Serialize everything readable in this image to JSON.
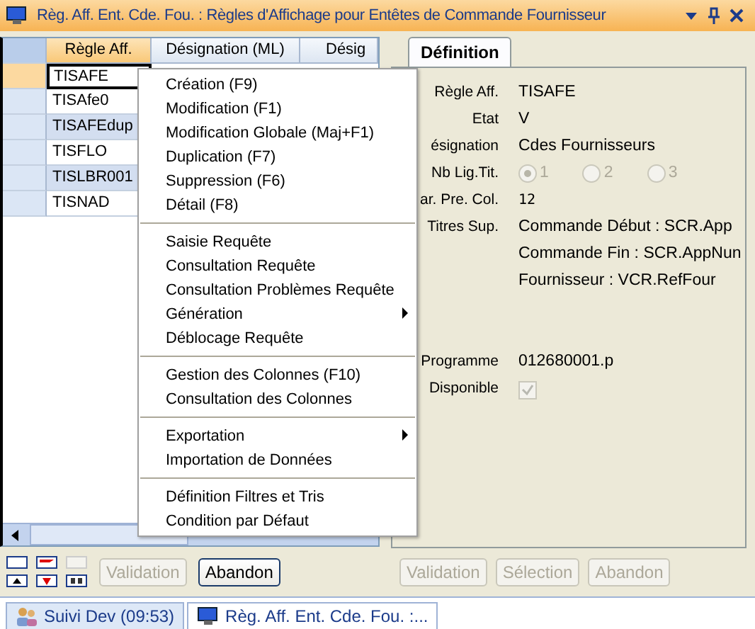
{
  "window": {
    "title": "Règ. Aff. Ent. Cde. Fou. : Règles d'Affichage pour Entêtes de Commande Fournisseur"
  },
  "grid": {
    "columns": [
      {
        "label": "Règle Aff.",
        "selected": true
      },
      {
        "label": "Désignation (ML)",
        "selected": false
      },
      {
        "label": "Désig",
        "selected": false
      }
    ],
    "rows": [
      {
        "rule": "TISAFE",
        "selected": true
      },
      {
        "rule": "TISAfe0",
        "selected": false
      },
      {
        "rule": "TISAFEdup",
        "selected": false
      },
      {
        "rule": "TISFLO",
        "selected": false
      },
      {
        "rule": "TISLBR001",
        "selected": false
      },
      {
        "rule": "TISNAD",
        "selected": false
      }
    ]
  },
  "left_buttons": [
    {
      "label": "Validation",
      "disabled": true
    },
    {
      "label": "Abandon",
      "disabled": false
    }
  ],
  "menu": [
    {
      "kind": "item",
      "label": "Création (F9)",
      "submenu": false
    },
    {
      "kind": "item",
      "label": "Modification (F1)",
      "submenu": false
    },
    {
      "kind": "item",
      "label": "Modification Globale (Maj+F1)",
      "submenu": false
    },
    {
      "kind": "item",
      "label": "Duplication (F7)",
      "submenu": false
    },
    {
      "kind": "item",
      "label": "Suppression (F6)",
      "submenu": false
    },
    {
      "kind": "item",
      "label": "Détail (F8)",
      "submenu": false
    },
    {
      "kind": "separator"
    },
    {
      "kind": "item",
      "label": "Saisie Requête",
      "submenu": false
    },
    {
      "kind": "item",
      "label": "Consultation Requête",
      "submenu": false
    },
    {
      "kind": "item",
      "label": "Consultation Problèmes Requête",
      "submenu": false
    },
    {
      "kind": "item",
      "label": "Génération",
      "submenu": true
    },
    {
      "kind": "item",
      "label": "Déblocage Requête",
      "submenu": false
    },
    {
      "kind": "separator"
    },
    {
      "kind": "item",
      "label": "Gestion des Colonnes (F10)",
      "submenu": false
    },
    {
      "kind": "item",
      "label": "Consultation des Colonnes",
      "submenu": false
    },
    {
      "kind": "separator"
    },
    {
      "kind": "item",
      "label": "Exportation",
      "submenu": true
    },
    {
      "kind": "item",
      "label": "Importation de Données",
      "submenu": false
    },
    {
      "kind": "separator"
    },
    {
      "kind": "item",
      "label": "Définition Filtres et Tris",
      "submenu": false
    },
    {
      "kind": "item",
      "label": "Condition par Défaut",
      "submenu": false
    }
  ],
  "detail": {
    "tab": {
      "label": "Définition",
      "selected": true
    },
    "fields": [
      {
        "kind": "text",
        "label": "Règle Aff.",
        "value": "TISAFE"
      },
      {
        "kind": "text",
        "label": "Etat",
        "value": "V"
      },
      {
        "kind": "text",
        "label": "ésignation",
        "value": "Cdes Fournisseurs"
      },
      {
        "kind": "radio",
        "label": "Nb Lig.Tit.",
        "options": [
          {
            "label": "1",
            "selected": true
          },
          {
            "label": "2",
            "selected": false
          },
          {
            "label": "3",
            "selected": false
          }
        ]
      },
      {
        "kind": "mono",
        "label": "ar. Pre. Col.",
        "value": "12"
      },
      {
        "kind": "lines",
        "label": "Titres Sup.",
        "values": [
          "Commande Début : SCR.App",
          "Commande Fin : SCR.AppNun",
          "Fournisseur : VCR.RefFour"
        ]
      },
      {
        "kind": "gap"
      },
      {
        "kind": "text",
        "label": "Programme",
        "value": "012680001.p"
      },
      {
        "kind": "checkbox",
        "label": "Disponible",
        "checked": true
      }
    ],
    "buttons": [
      {
        "label": "Validation",
        "disabled": true
      },
      {
        "label": "Sélection",
        "disabled": true
      },
      {
        "label": "Abandon",
        "disabled": true
      }
    ]
  },
  "taskbar": [
    {
      "label": "Suivi Dev (09:53)",
      "selected": false
    },
    {
      "label": "Règ. Aff. Ent. Cde. Fou. :...",
      "selected": true
    }
  ]
}
